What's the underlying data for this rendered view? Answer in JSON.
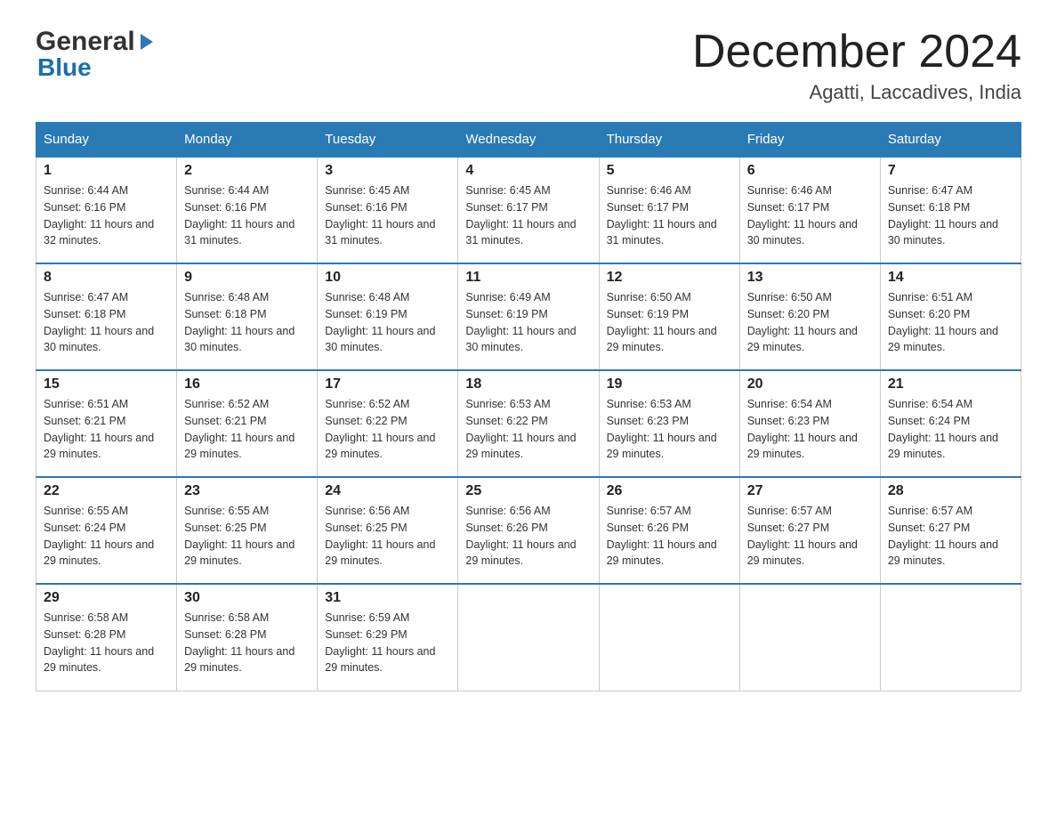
{
  "header": {
    "logo_general": "General",
    "logo_blue": "Blue",
    "month_title": "December 2024",
    "location": "Agatti, Laccadives, India"
  },
  "days_of_week": [
    "Sunday",
    "Monday",
    "Tuesday",
    "Wednesday",
    "Thursday",
    "Friday",
    "Saturday"
  ],
  "weeks": [
    [
      {
        "day": "1",
        "sunrise": "6:44 AM",
        "sunset": "6:16 PM",
        "daylight": "11 hours and 32 minutes."
      },
      {
        "day": "2",
        "sunrise": "6:44 AM",
        "sunset": "6:16 PM",
        "daylight": "11 hours and 31 minutes."
      },
      {
        "day": "3",
        "sunrise": "6:45 AM",
        "sunset": "6:16 PM",
        "daylight": "11 hours and 31 minutes."
      },
      {
        "day": "4",
        "sunrise": "6:45 AM",
        "sunset": "6:17 PM",
        "daylight": "11 hours and 31 minutes."
      },
      {
        "day": "5",
        "sunrise": "6:46 AM",
        "sunset": "6:17 PM",
        "daylight": "11 hours and 31 minutes."
      },
      {
        "day": "6",
        "sunrise": "6:46 AM",
        "sunset": "6:17 PM",
        "daylight": "11 hours and 30 minutes."
      },
      {
        "day": "7",
        "sunrise": "6:47 AM",
        "sunset": "6:18 PM",
        "daylight": "11 hours and 30 minutes."
      }
    ],
    [
      {
        "day": "8",
        "sunrise": "6:47 AM",
        "sunset": "6:18 PM",
        "daylight": "11 hours and 30 minutes."
      },
      {
        "day": "9",
        "sunrise": "6:48 AM",
        "sunset": "6:18 PM",
        "daylight": "11 hours and 30 minutes."
      },
      {
        "day": "10",
        "sunrise": "6:48 AM",
        "sunset": "6:19 PM",
        "daylight": "11 hours and 30 minutes."
      },
      {
        "day": "11",
        "sunrise": "6:49 AM",
        "sunset": "6:19 PM",
        "daylight": "11 hours and 30 minutes."
      },
      {
        "day": "12",
        "sunrise": "6:50 AM",
        "sunset": "6:19 PM",
        "daylight": "11 hours and 29 minutes."
      },
      {
        "day": "13",
        "sunrise": "6:50 AM",
        "sunset": "6:20 PM",
        "daylight": "11 hours and 29 minutes."
      },
      {
        "day": "14",
        "sunrise": "6:51 AM",
        "sunset": "6:20 PM",
        "daylight": "11 hours and 29 minutes."
      }
    ],
    [
      {
        "day": "15",
        "sunrise": "6:51 AM",
        "sunset": "6:21 PM",
        "daylight": "11 hours and 29 minutes."
      },
      {
        "day": "16",
        "sunrise": "6:52 AM",
        "sunset": "6:21 PM",
        "daylight": "11 hours and 29 minutes."
      },
      {
        "day": "17",
        "sunrise": "6:52 AM",
        "sunset": "6:22 PM",
        "daylight": "11 hours and 29 minutes."
      },
      {
        "day": "18",
        "sunrise": "6:53 AM",
        "sunset": "6:22 PM",
        "daylight": "11 hours and 29 minutes."
      },
      {
        "day": "19",
        "sunrise": "6:53 AM",
        "sunset": "6:23 PM",
        "daylight": "11 hours and 29 minutes."
      },
      {
        "day": "20",
        "sunrise": "6:54 AM",
        "sunset": "6:23 PM",
        "daylight": "11 hours and 29 minutes."
      },
      {
        "day": "21",
        "sunrise": "6:54 AM",
        "sunset": "6:24 PM",
        "daylight": "11 hours and 29 minutes."
      }
    ],
    [
      {
        "day": "22",
        "sunrise": "6:55 AM",
        "sunset": "6:24 PM",
        "daylight": "11 hours and 29 minutes."
      },
      {
        "day": "23",
        "sunrise": "6:55 AM",
        "sunset": "6:25 PM",
        "daylight": "11 hours and 29 minutes."
      },
      {
        "day": "24",
        "sunrise": "6:56 AM",
        "sunset": "6:25 PM",
        "daylight": "11 hours and 29 minutes."
      },
      {
        "day": "25",
        "sunrise": "6:56 AM",
        "sunset": "6:26 PM",
        "daylight": "11 hours and 29 minutes."
      },
      {
        "day": "26",
        "sunrise": "6:57 AM",
        "sunset": "6:26 PM",
        "daylight": "11 hours and 29 minutes."
      },
      {
        "day": "27",
        "sunrise": "6:57 AM",
        "sunset": "6:27 PM",
        "daylight": "11 hours and 29 minutes."
      },
      {
        "day": "28",
        "sunrise": "6:57 AM",
        "sunset": "6:27 PM",
        "daylight": "11 hours and 29 minutes."
      }
    ],
    [
      {
        "day": "29",
        "sunrise": "6:58 AM",
        "sunset": "6:28 PM",
        "daylight": "11 hours and 29 minutes."
      },
      {
        "day": "30",
        "sunrise": "6:58 AM",
        "sunset": "6:28 PM",
        "daylight": "11 hours and 29 minutes."
      },
      {
        "day": "31",
        "sunrise": "6:59 AM",
        "sunset": "6:29 PM",
        "daylight": "11 hours and 29 minutes."
      },
      {
        "day": "",
        "sunrise": "",
        "sunset": "",
        "daylight": ""
      },
      {
        "day": "",
        "sunrise": "",
        "sunset": "",
        "daylight": ""
      },
      {
        "day": "",
        "sunrise": "",
        "sunset": "",
        "daylight": ""
      },
      {
        "day": "",
        "sunrise": "",
        "sunset": "",
        "daylight": ""
      }
    ]
  ],
  "labels": {
    "sunrise_prefix": "Sunrise: ",
    "sunset_prefix": "Sunset: ",
    "daylight_prefix": "Daylight: "
  }
}
